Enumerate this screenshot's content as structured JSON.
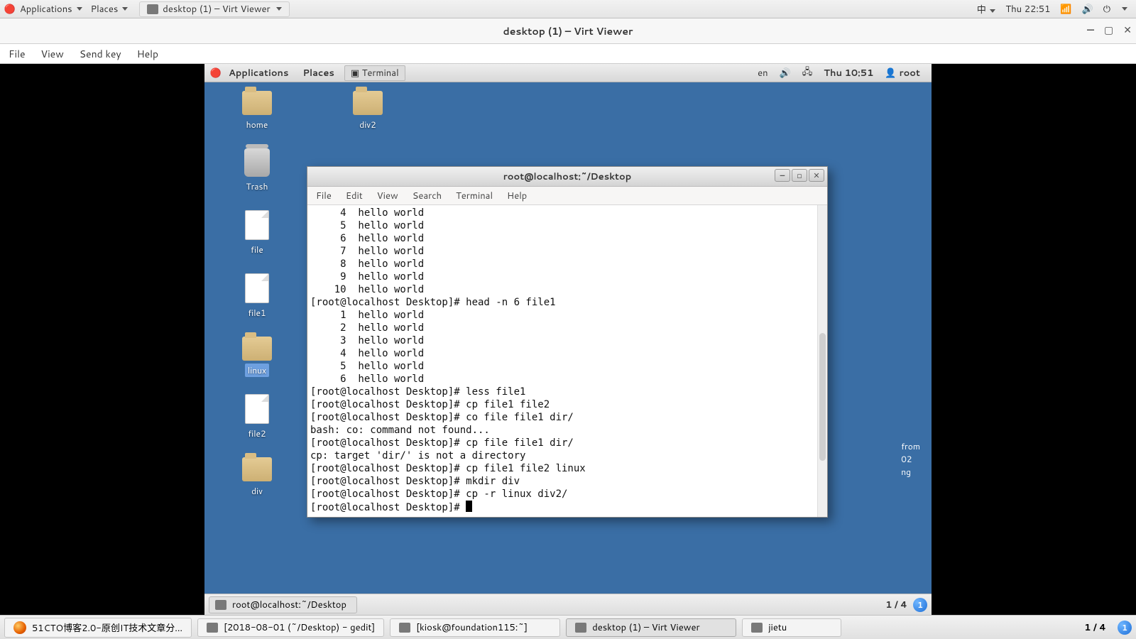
{
  "outer_topbar": {
    "applications": "Applications",
    "places": "Places",
    "active_task": "desktop (1) – Virt Viewer",
    "ime": "中",
    "clock": "Thu 22:51"
  },
  "virt": {
    "title": "desktop (1) – Virt Viewer",
    "menus": {
      "file": "File",
      "view": "View",
      "sendkey": "Send key",
      "help": "Help"
    }
  },
  "guest_topbar": {
    "applications": "Applications",
    "places": "Places",
    "task": "Terminal",
    "lang": "en",
    "clock": "Thu 10:51",
    "user": "root"
  },
  "desktop_icons": {
    "home": "home",
    "trash": "Trash",
    "file": "file",
    "file1": "file1",
    "linux": "linux",
    "file2": "file2",
    "div": "div",
    "div2": "div2"
  },
  "terminal": {
    "title": "root@localhost:~/Desktop",
    "menus": {
      "file": "File",
      "edit": "Edit",
      "view": "View",
      "search": "Search",
      "terminal": "Terminal",
      "help": "Help"
    },
    "lines": [
      "     4  hello world",
      "     5  hello world",
      "     6  hello world",
      "     7  hello world",
      "     8  hello world",
      "     9  hello world",
      "    10  hello world",
      "[root@localhost Desktop]# head -n 6 file1",
      "     1  hello world",
      "     2  hello world",
      "     3  hello world",
      "     4  hello world",
      "     5  hello world",
      "     6  hello world",
      "[root@localhost Desktop]# less file1",
      "[root@localhost Desktop]# cp file1 file2",
      "[root@localhost Desktop]# co file file1 dir/",
      "bash: co: command not found...",
      "[root@localhost Desktop]# cp file file1 dir/",
      "cp: target 'dir/' is not a directory",
      "[root@localhost Desktop]# cp file1 file2 linux",
      "[root@localhost Desktop]# mkdir div",
      "[root@localhost Desktop]# cp -r linux div2/"
    ],
    "prompt": "[root@localhost Desktop]# "
  },
  "notif_peek": {
    "l1": "from",
    "l2": "02",
    "l3": "ng"
  },
  "guest_bottombar": {
    "task": "root@localhost:~/Desktop",
    "workspace": "1 / 4",
    "badge": "1"
  },
  "outer_bottombar": {
    "tasks": [
      "51CTO博客2.0-原创IT技术文章分…",
      "[2018-08-01 (~/Desktop) - gedit]",
      "[kiosk@foundation115:~]",
      "desktop (1) – Virt Viewer",
      "jietu"
    ],
    "workspace": "1 / 4",
    "badge": "1"
  }
}
